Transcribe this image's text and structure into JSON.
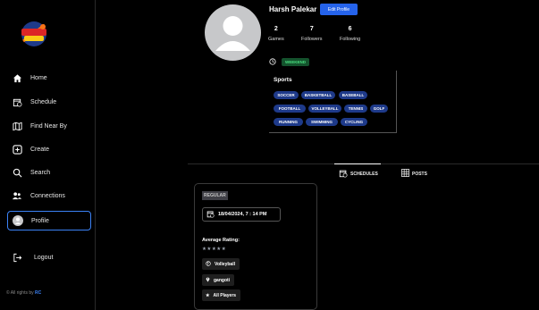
{
  "colors": {
    "accent": "#2563eb",
    "chip": "#1e3a8a",
    "weekend_bg": "#14532d",
    "weekend_text": "#4ade80"
  },
  "sidebar": {
    "logo_icon": "seek-n-play-logo",
    "items": [
      {
        "label": "Home",
        "icon": "home-icon"
      },
      {
        "label": "Schedule",
        "icon": "calendar-icon"
      },
      {
        "label": "Find Near By",
        "icon": "map-icon"
      },
      {
        "label": "Create",
        "icon": "plus-square-icon"
      },
      {
        "label": "Search",
        "icon": "search-icon"
      },
      {
        "label": "Connections",
        "icon": "people-icon"
      },
      {
        "label": "Profile",
        "icon": "avatar-icon",
        "active": true
      },
      {
        "label": "Logout",
        "icon": "logout-icon"
      }
    ],
    "footer": {
      "text": "© All rights by ",
      "brand": "RC"
    }
  },
  "profile": {
    "name": "Harsh Palekar",
    "edit_label": "Edit Profile",
    "stats": [
      {
        "value": "2",
        "label": "Games"
      },
      {
        "value": "7",
        "label": "Followers"
      },
      {
        "value": "6",
        "label": "Following"
      }
    ],
    "availability": "WEEKEND",
    "sports_title": "Sports",
    "sports": [
      "SOCCER",
      "BASKETBALL",
      "BASEBALL",
      "FOOTBALL",
      "VOLLEYBALL",
      "TENNIS",
      "GOLF",
      "RUNNING",
      "SWIMMING",
      "CYCLING"
    ]
  },
  "tabs": [
    {
      "label": "SCHEDULES",
      "icon": "calendar-icon",
      "active": true
    },
    {
      "label": "POSTS",
      "icon": "grid-icon",
      "active": false
    }
  ],
  "schedule_card": {
    "type": "REGULAR",
    "datetime": "18/04/2024, 7 : 14 PM",
    "rating_label": "Average Rating:",
    "rating_stars": "★★★★★",
    "sport": "Volleyball",
    "location": "gangoti",
    "audience": "All Players"
  }
}
